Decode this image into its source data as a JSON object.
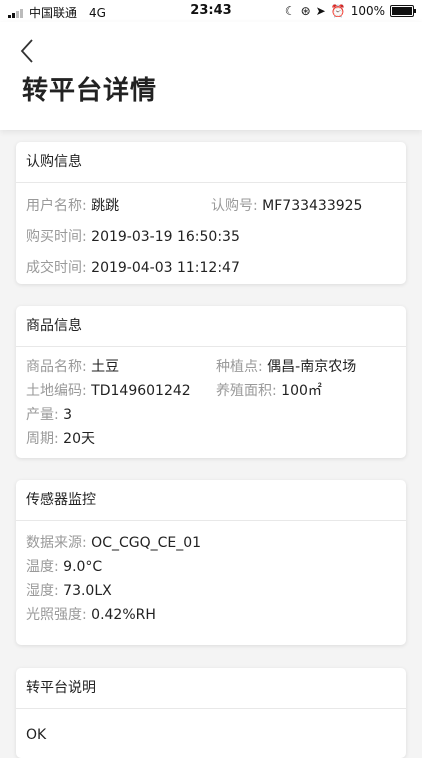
{
  "status_bar": {
    "carrier": "中国联通",
    "network": "4G",
    "time": "23:43",
    "battery": "100%"
  },
  "header": {
    "title": "转平台详情"
  },
  "subscription": {
    "heading": "认购信息",
    "user_label": "用户名称:",
    "user_value": "跳跳",
    "sub_no_label": "认购号:",
    "sub_no_value": "MF733433925",
    "buy_time_label": "购买时间:",
    "buy_time_value": "2019-03-19 16:50:35",
    "deal_time_label": "成交时间:",
    "deal_time_value": "2019-04-03 11:12:47"
  },
  "product": {
    "heading": "商品信息",
    "name_label": "商品名称:",
    "name_value": "土豆",
    "plant_label": "种植点:",
    "plant_value": "偶昌-南京农场",
    "land_label": "土地编码:",
    "land_value": "TD149601242",
    "area_label": "养殖面积:",
    "area_value": "100㎡",
    "output_label": "产量:",
    "output_value": "3",
    "cycle_label": "周期:",
    "cycle_value": "20天"
  },
  "sensor": {
    "heading": "传感器监控",
    "source_label": "数据来源:",
    "source_value": "OC_CGQ_CE_01",
    "temp_label": "温度:",
    "temp_value": "9.0°C",
    "humidity_label": "湿度:",
    "humidity_value": "73.0LX",
    "light_label": "光照强度:",
    "light_value": "0.42%RH"
  },
  "transfer": {
    "heading": "转平台说明",
    "content": "OK"
  }
}
